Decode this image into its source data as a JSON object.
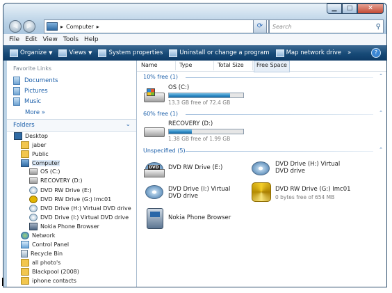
{
  "window": {
    "controls": {
      "minimize": "▁",
      "maximize": "□",
      "close": "✕"
    }
  },
  "address": {
    "path": "Computer",
    "separator": "▸",
    "dropdown_glyph": "▾"
  },
  "search": {
    "placeholder": "Search"
  },
  "menu": [
    "File",
    "Edit",
    "View",
    "Tools",
    "Help"
  ],
  "toolbar": {
    "items": [
      {
        "label": "Organize",
        "has_arrow": true
      },
      {
        "label": "Views",
        "has_arrow": true
      },
      {
        "label": "System properties",
        "has_arrow": false
      },
      {
        "label": "Uninstall or change a program",
        "has_arrow": false
      },
      {
        "label": "Map network drive",
        "has_arrow": false
      }
    ],
    "overflow": "»",
    "help": "?"
  },
  "sidebar": {
    "favorites_title": "Favorite Links",
    "favorites": [
      "Documents",
      "Pictures",
      "Music"
    ],
    "more": "More  »",
    "folders_title": "Folders",
    "tree": [
      {
        "label": "Desktop",
        "icon": "desktop-icon",
        "level": 0
      },
      {
        "label": "jaber",
        "icon": "user-folder-icon",
        "level": 1
      },
      {
        "label": "Public",
        "icon": "folder-icon",
        "level": 1
      },
      {
        "label": "Computer",
        "icon": "computer-icon",
        "level": 1,
        "selected": true
      },
      {
        "label": "OS (C:)",
        "icon": "windows-drive-icon",
        "level": 2
      },
      {
        "label": "RECOVERY (D:)",
        "icon": "drive-icon",
        "level": 2
      },
      {
        "label": "DVD RW Drive (E:)",
        "icon": "dvd-icon",
        "level": 2
      },
      {
        "label": "DVD RW Drive (G:) Imc01",
        "icon": "gold-disc-icon",
        "level": 2
      },
      {
        "label": "DVD Drive (H:) Virtual DVD drive",
        "icon": "dvd-icon",
        "level": 2
      },
      {
        "label": "DVD Drive (I:) Virtual DVD drive",
        "icon": "dvd-icon",
        "level": 2
      },
      {
        "label": "Nokia Phone Browser",
        "icon": "phone-icon",
        "level": 2
      },
      {
        "label": "Network",
        "icon": "network-icon",
        "level": 1
      },
      {
        "label": "Control Panel",
        "icon": "control-panel-icon",
        "level": 1
      },
      {
        "label": "Recycle Bin",
        "icon": "recycle-bin-icon",
        "level": 1
      },
      {
        "label": "all photo's",
        "icon": "folder-icon",
        "level": 1
      },
      {
        "label": "Blackpool (2008)",
        "icon": "folder-icon",
        "level": 1
      },
      {
        "label": "iphone contacts",
        "icon": "folder-icon",
        "level": 1
      }
    ]
  },
  "columns": [
    "Name",
    "Type",
    "Total Size",
    "Free Space"
  ],
  "groups": {
    "g1": "10% free (1)",
    "g2": "60% free (1)",
    "g3": "Unspecified (5)"
  },
  "drives": {
    "c": {
      "name": "OS (C:)",
      "detail": "13.3 GB free of 72.4 GB",
      "used_fraction": 0.82
    },
    "d": {
      "name": "RECOVERY (D:)",
      "detail": "1.38 GB free of 1.99 GB",
      "used_fraction": 0.31
    }
  },
  "devices": {
    "e": {
      "name": "DVD RW Drive (E:)"
    },
    "h": {
      "name": "DVD Drive (H:) Virtual DVD drive"
    },
    "i": {
      "name": "DVD Drive (I:) Virtual DVD drive"
    },
    "g": {
      "name": "DVD RW Drive (G:) Imc01",
      "detail": "0 bytes free of 654 MB"
    },
    "nokia": {
      "name": "Nokia Phone Browser"
    }
  },
  "icons": {
    "dvd_badge": "DVD",
    "collapse": "⌃",
    "chevron": "⌄"
  }
}
